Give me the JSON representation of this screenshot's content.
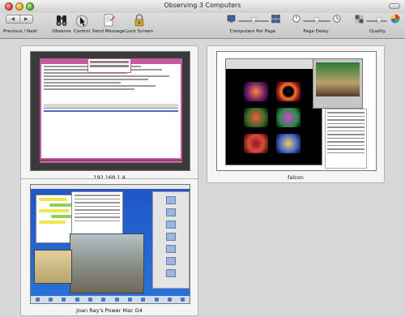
{
  "window": {
    "title": "Observing 3 Computers"
  },
  "toolbar": {
    "nav_label": "Previous / Next",
    "nav_prev_glyph": "◀",
    "nav_next_glyph": "▶",
    "observe_label": "Observe",
    "control_label": "Control",
    "send_message_label": "Send Message",
    "lock_screen_label": "Lock Screen",
    "computers_per_page_label": "Computers Per Page",
    "page_delay_label": "Page Delay",
    "quality_label": "Quality"
  },
  "computers": [
    {
      "name": "192.168.1.4"
    },
    {
      "name": "falcon"
    },
    {
      "name": "Joan Ray's Power Mac G4"
    }
  ],
  "sliders": {
    "computers_per_page_level": 0.5,
    "page_delay_level": 0.5,
    "quality_level": 0.6
  }
}
